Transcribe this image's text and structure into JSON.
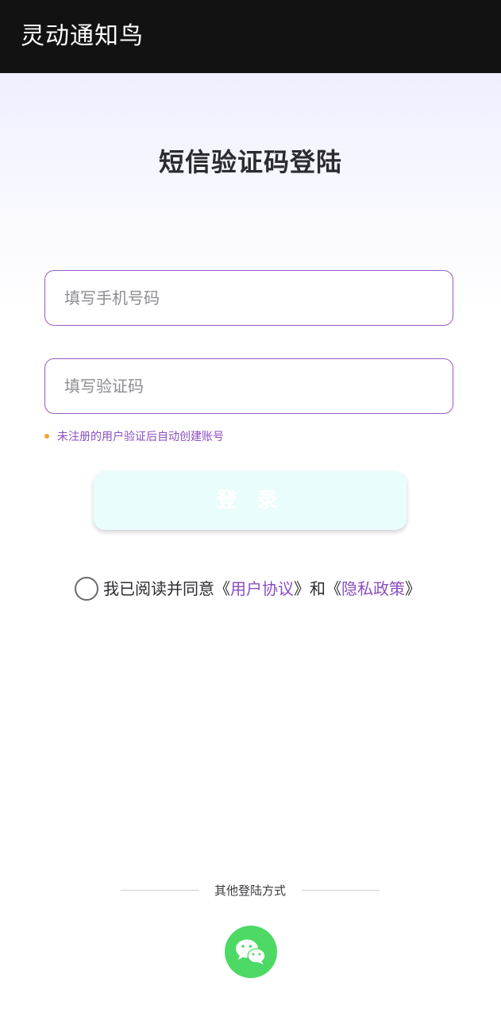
{
  "app": {
    "title": "灵动通知鸟"
  },
  "login": {
    "page_title": "短信验证码登陆",
    "phone_placeholder": "填写手机号码",
    "code_placeholder": "填写验证码",
    "hint": "未注册的用户验证后自动创建账号",
    "login_label": "登 录"
  },
  "agreement": {
    "prefix": "我已阅读并同意",
    "open_quote_1": "《",
    "user_agreement": "用户协议",
    "close_quote_1": "》",
    "and": "和",
    "open_quote_2": "《",
    "privacy_policy": "隐私政策",
    "close_quote_2": "》",
    "checked": false
  },
  "other_login": {
    "label": "其他登陆方式",
    "wechat_icon": "wechat-icon"
  },
  "colors": {
    "accent": "#8a4fc0",
    "border": "#9a5ac8",
    "login_button_bg": "#e9fdfc",
    "hint_dot": "#f2a531",
    "wechat_green": "#4cd964",
    "titlebar": "#121212"
  }
}
